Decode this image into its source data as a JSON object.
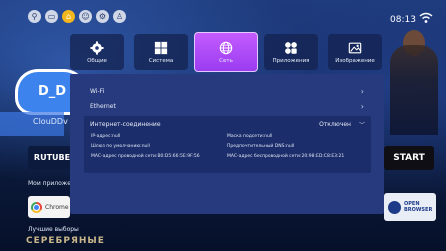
{
  "status_bar": {
    "icons": [
      "search-icon",
      "input-icon",
      "home-icon",
      "face-icon",
      "settings-icon",
      "user-icon"
    ],
    "active_icon": "home-icon",
    "time": "08:13"
  },
  "background": {
    "cloud_text": "D_D",
    "cloud_subtext": "ClouDDv",
    "rutube": "RUTUBE",
    "my_apps": "Мои приложен",
    "chrome": "Chrome",
    "best_picks": "Лучшие выборы",
    "poster_text": "СЕРЕБРЯНЫЕ",
    "start": "START",
    "open_browser_line1": "OPEN",
    "open_browser_line2": "BROWSER"
  },
  "tabs": [
    {
      "label": "Общие",
      "icon": "gear-icon"
    },
    {
      "label": "Система",
      "icon": "windows-icon"
    },
    {
      "label": "Сеть",
      "icon": "globe-icon",
      "active": true
    },
    {
      "label": "Приложения",
      "icon": "apps-icon"
    },
    {
      "label": "Изображение",
      "icon": "image-icon"
    }
  ],
  "settings": {
    "wifi": "Wi-Fi",
    "ethernet": "Ethernet",
    "internet_label": "Интернет-соединение",
    "internet_value": "Отключен",
    "info": {
      "ip": "IP-адрес:null",
      "mask": "Маска подсети:null",
      "gateway": "Шлюз по умолчанию:null",
      "dns": "Предпочтительный DNS:null",
      "mac_wired": "MAC-адрес проводной сети:B0:D5:66:5E:9F:56",
      "mac_wireless": "MAC-адрес беспроводной сети:20:98:ED:C8:E3:21"
    }
  },
  "colors": {
    "panel": "#263a7d",
    "inner_panel": "#1b2d6a",
    "active_tab": "#b04cf8",
    "active_status": "#f2b81e"
  }
}
